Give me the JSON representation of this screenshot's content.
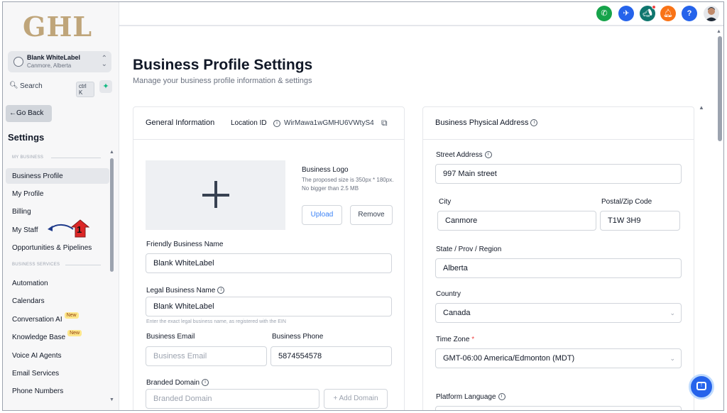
{
  "sidebar": {
    "logo": "GHL",
    "account": {
      "name": "Blank WhiteLabel",
      "location": "Canmore, Alberta"
    },
    "search": {
      "label": "Search",
      "shortcut": "ctrl K"
    },
    "go_back": "Go Back",
    "title": "Settings",
    "section_my_business": "MY BUSINESS",
    "section_business_services": "BUSINESS SERVICES",
    "items": [
      {
        "label": "Business Profile"
      },
      {
        "label": "My Profile"
      },
      {
        "label": "Billing"
      },
      {
        "label": "My Staff"
      },
      {
        "label": "Opportunities & Pipelines"
      },
      {
        "label": "Automation"
      },
      {
        "label": "Calendars"
      },
      {
        "label": "Conversation AI",
        "badge": "New"
      },
      {
        "label": "Knowledge Base",
        "badge": "New"
      },
      {
        "label": "Voice AI Agents"
      },
      {
        "label": "Email Services"
      },
      {
        "label": "Phone Numbers"
      }
    ],
    "step_marker": "1"
  },
  "topbar": {
    "icons": [
      "phone-icon",
      "megaphone-icon",
      "announcement-icon",
      "bell-icon",
      "help-icon"
    ],
    "colors": {
      "phone": "#16a34a",
      "launch": "#2563eb",
      "announce": "#0f766e",
      "bell": "#f97316",
      "help": "#2563eb"
    },
    "help_label": "?"
  },
  "page": {
    "title": "Business Profile Settings",
    "subtitle": "Manage your business profile information & settings"
  },
  "general": {
    "title": "General Information",
    "location_id_label": "Location ID",
    "location_id_value": "WirMawa1wGMHU6VWtyS4",
    "logo_title": "Business Logo",
    "logo_hint": "The proposed size is 350px * 180px. No bigger than 2.5 MB",
    "upload": "Upload",
    "remove": "Remove",
    "friendly_name_label": "Friendly Business Name",
    "friendly_name_value": "Blank WhiteLabel",
    "legal_name_label": "Legal Business Name",
    "legal_name_value": "Blank WhiteLabel",
    "legal_name_hint": "Enter the exact legal business name, as registered with the EIN",
    "email_label": "Business Email",
    "email_placeholder": "Business Email",
    "phone_label": "Business Phone",
    "phone_value": "5874554578",
    "domain_label": "Branded Domain",
    "domain_placeholder": "Branded Domain",
    "add_domain": "+ Add Domain"
  },
  "address": {
    "title": "Business Physical Address",
    "street_label": "Street Address",
    "street_value": "997 Main street",
    "city_label": "City",
    "city_value": "Canmore",
    "postal_label": "Postal/Zip Code",
    "postal_value": "T1W 3H9",
    "state_label": "State / Prov / Region",
    "state_value": "Alberta",
    "country_label": "Country",
    "country_value": "Canada",
    "timezone_label": "Time Zone",
    "timezone_required": "*",
    "timezone_value": "GMT-06:00 America/Edmonton (MDT)",
    "language_label": "Platform Language"
  }
}
